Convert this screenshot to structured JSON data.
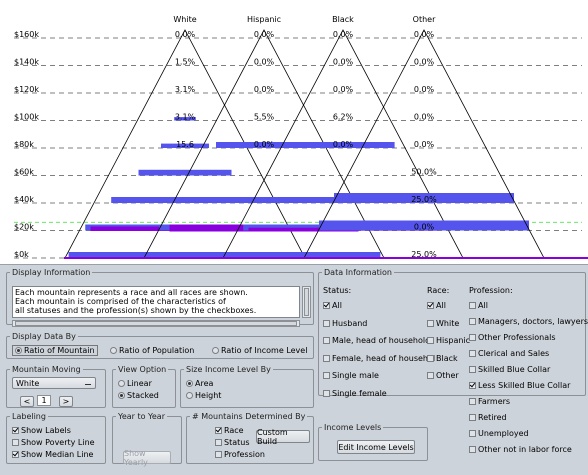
{
  "chart": {
    "columns": [
      "White",
      "Hispanic",
      "Black",
      "Other"
    ],
    "y_labels": [
      "$160k",
      "$140k",
      "$120k",
      "$100k",
      "$80k",
      "$60k",
      "$40k",
      "$20k",
      "$0k"
    ],
    "colors": {
      "bar": "#5555ee",
      "median": "#8800dd",
      "poverty": "#33dd33",
      "outline": "#000000"
    }
  },
  "chart_data": {
    "type": "bar",
    "title": "",
    "y_ticks": [
      "$160k",
      "$140k",
      "$120k",
      "$100k",
      "$80k",
      "$60k",
      "$40k",
      "$20k",
      "$0k"
    ],
    "ylim": [
      0,
      160
    ],
    "series": [
      {
        "name": "White",
        "percents": [
          "0.0%",
          "1.5%",
          "3.1%",
          "3.1%",
          "15.6"
        ],
        "bar_widths": [
          0,
          0,
          0.24,
          0.4,
          0.62,
          0.82,
          0.95,
          0.97
        ],
        "median": 5
      },
      {
        "name": "Hispanic",
        "percents": [
          "0.0%",
          "0.0%",
          "0.0%",
          "5.5%",
          "0.0%"
        ],
        "bar_widths": [
          0,
          0,
          0,
          0.8,
          0,
          0.85,
          1.0,
          0.97
        ],
        "median": 10
      },
      {
        "name": "Black",
        "percents": [
          "0.0%",
          "0.0%",
          "0.0%",
          "6.2%",
          "0.0%"
        ],
        "bar_widths": [
          0,
          0,
          0,
          0.86,
          0,
          0.75,
          0.95,
          0.0
        ],
        "median": 2
      },
      {
        "name": "Other",
        "percents": [
          "0.0%",
          "0.0%",
          "0.0%",
          "0.0%",
          "0.0%",
          "50.0%",
          "25.0%",
          "0.0%",
          "25.0%"
        ],
        "bar_widths": [
          0,
          0,
          0,
          0,
          0,
          1.0,
          1.0,
          0,
          1.0
        ]
      }
    ]
  },
  "display_info": {
    "legend": "Display Information",
    "lines": [
      "Each mountain represents a race and all races are shown.",
      "Each mountain is comprised of the characteristics of",
      "all statuses and the profession(s) shown by the checkboxes."
    ]
  },
  "display_data_by": {
    "legend": "Display Data By",
    "options": [
      {
        "label": "Ratio of Mountain",
        "selected": true
      },
      {
        "label": "Ratio of Population",
        "selected": false
      },
      {
        "label": "Ratio of Income Level",
        "selected": false
      }
    ]
  },
  "mountain_moving": {
    "legend": "Mountain Moving",
    "selected": "White",
    "value": "1",
    "prev": "<",
    "next": ">"
  },
  "view_option": {
    "legend": "View Option",
    "options": [
      {
        "label": "Linear",
        "selected": false
      },
      {
        "label": "Stacked",
        "selected": true
      }
    ]
  },
  "size_income": {
    "legend": "Size Income Level By",
    "options": [
      {
        "label": "Area",
        "selected": true
      },
      {
        "label": "Height",
        "selected": false
      }
    ]
  },
  "labeling": {
    "legend": "Labeling",
    "options": [
      {
        "label": "Show Labels",
        "checked": true
      },
      {
        "label": "Show Poverty Line",
        "checked": false
      },
      {
        "label": "Show Median Line",
        "checked": true
      }
    ]
  },
  "year_to_year": {
    "legend": "Year to Year",
    "button": "Show Yearly"
  },
  "mountains_determined": {
    "legend": "# Mountains Determined By",
    "options": [
      {
        "label": "Race",
        "checked": true
      },
      {
        "label": "Status",
        "checked": false
      },
      {
        "label": "Profession",
        "checked": false
      }
    ],
    "button": "Custom Build"
  },
  "data_info": {
    "legend": "Data Information",
    "status_header": "Status:",
    "race_header": "Race:",
    "profession_header": "Profession:",
    "status": [
      {
        "label": "All",
        "checked": true
      },
      {
        "label": "Husband",
        "checked": false
      },
      {
        "label": "Male, head of household",
        "checked": false
      },
      {
        "label": "Female, head of househol",
        "checked": false
      },
      {
        "label": "Single male",
        "checked": false
      },
      {
        "label": "Single female",
        "checked": false
      }
    ],
    "race": [
      {
        "label": "All",
        "checked": true
      },
      {
        "label": "White",
        "checked": false
      },
      {
        "label": "Hispanic",
        "checked": false
      },
      {
        "label": "Black",
        "checked": false
      },
      {
        "label": "Other",
        "checked": false
      }
    ],
    "profession": [
      {
        "label": "All",
        "checked": false
      },
      {
        "label": "Managers, doctors, lawyers",
        "checked": false
      },
      {
        "label": "Other Professionals",
        "checked": false
      },
      {
        "label": "Clerical and Sales",
        "checked": false
      },
      {
        "label": "Skilled Blue Collar",
        "checked": false
      },
      {
        "label": "Less Skilled Blue Collar",
        "checked": true
      },
      {
        "label": "Farmers",
        "checked": false
      },
      {
        "label": "Retired",
        "checked": false
      },
      {
        "label": "Unemployed",
        "checked": false
      },
      {
        "label": "Other not in labor force",
        "checked": false
      }
    ]
  },
  "income_levels": {
    "legend": "Income Levels",
    "button": "Edit Income Levels"
  }
}
